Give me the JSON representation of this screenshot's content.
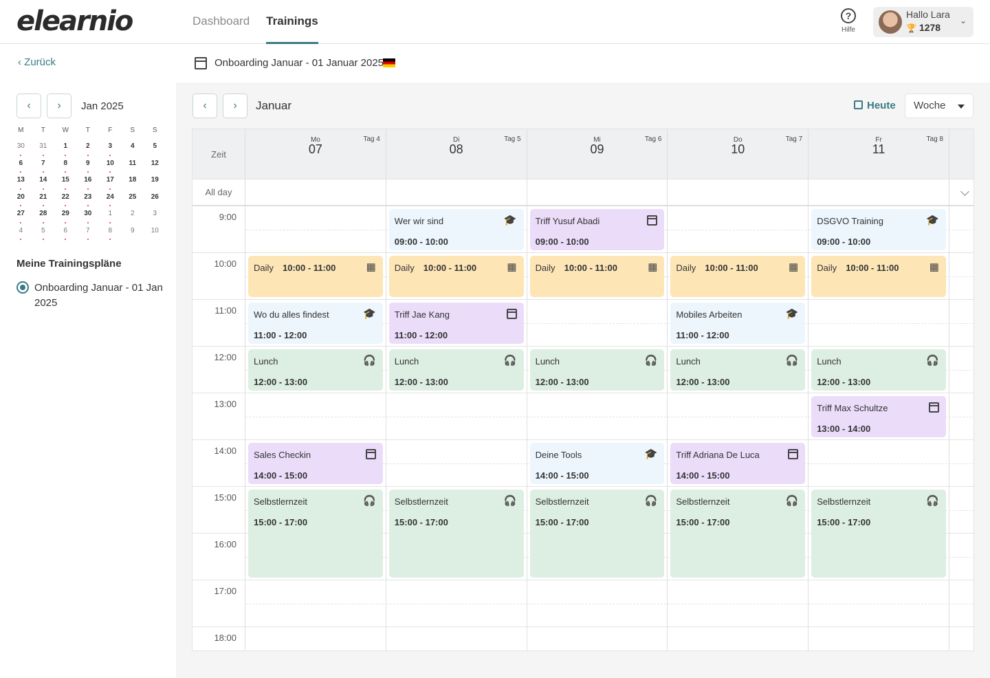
{
  "app": {
    "logo": "elearnio"
  },
  "nav": {
    "tabs": [
      {
        "label": "Dashboard"
      },
      {
        "label": "Trainings"
      }
    ],
    "active": "Trainings"
  },
  "help": {
    "label": "Hilfe"
  },
  "user": {
    "greeting": "Hallo Lara",
    "points": "1278"
  },
  "sidebar": {
    "back_label": "Zurück",
    "mini_calendar": {
      "label": "Jan 2025",
      "weekdays": [
        "M",
        "T",
        "W",
        "T",
        "F",
        "S",
        "S"
      ],
      "weeks": [
        [
          "30",
          "31",
          "1",
          "2",
          "3",
          "4",
          "5"
        ],
        [
          "6",
          "7",
          "8",
          "9",
          "10",
          "11",
          "12"
        ],
        [
          "13",
          "14",
          "15",
          "16",
          "17",
          "18",
          "19"
        ],
        [
          "20",
          "21",
          "22",
          "23",
          "24",
          "25",
          "26"
        ],
        [
          "27",
          "28",
          "29",
          "30",
          "1",
          "2",
          "3"
        ],
        [
          "4",
          "5",
          "6",
          "7",
          "8",
          "9",
          "10"
        ]
      ]
    },
    "plans_title": "Meine Trainingspläne",
    "plan_label": "Onboarding Januar - 01 Jan 2025"
  },
  "course": {
    "title": "Onboarding Januar - 01 Januar 2025"
  },
  "calendar": {
    "month_label": "Januar",
    "today_label": "Heute",
    "view": "Woche",
    "zeit_label": "Zeit",
    "allday_label": "All day",
    "days": [
      {
        "dow": "Mo",
        "num": "07",
        "tag": "Tag 4"
      },
      {
        "dow": "Di",
        "num": "08",
        "tag": "Tag 5"
      },
      {
        "dow": "Mi",
        "num": "09",
        "tag": "Tag 6"
      },
      {
        "dow": "Do",
        "num": "10",
        "tag": "Tag 7"
      },
      {
        "dow": "Fr",
        "num": "11",
        "tag": "Tag 8"
      }
    ],
    "hours": [
      "9:00",
      "10:00",
      "11:00",
      "12:00",
      "13:00",
      "14:00",
      "15:00",
      "16:00",
      "17:00",
      "18:00"
    ],
    "events": [
      {
        "day": 1,
        "title": "Wer wir sind",
        "time": "09:00 - 10:00",
        "color": "#edf6fd",
        "icon": "graduation-cap-icon"
      },
      {
        "day": 2,
        "title": "Triff Yusuf Abadi",
        "time": "09:00 - 10:00",
        "color": "#ebdcfa",
        "icon": "calendar-icon"
      },
      {
        "day": 4,
        "title": "DSGVO Training",
        "time": "09:00 - 10:00",
        "color": "#edf6fd",
        "icon": "graduation-cap-icon"
      },
      {
        "day": 0,
        "title": "Daily",
        "time": "10:00 - 11:00",
        "color": "#fde5b6",
        "icon": "presentation-icon"
      },
      {
        "day": 1,
        "title": "Daily",
        "time": "10:00 - 11:00",
        "color": "#fde5b6",
        "icon": "presentation-icon"
      },
      {
        "day": 2,
        "title": "Daily",
        "time": "10:00 - 11:00",
        "color": "#fde5b6",
        "icon": "presentation-icon"
      },
      {
        "day": 3,
        "title": "Daily",
        "time": "10:00 - 11:00",
        "color": "#fde5b6",
        "icon": "presentation-icon"
      },
      {
        "day": 4,
        "title": "Daily",
        "time": "10:00 - 11:00",
        "color": "#fde5b6",
        "icon": "presentation-icon"
      },
      {
        "day": 0,
        "title": "Wo du alles findest",
        "time": "11:00 - 12:00",
        "color": "#edf6fd",
        "icon": "graduation-cap-icon"
      },
      {
        "day": 1,
        "title": "Triff Jae Kang",
        "time": "11:00 - 12:00",
        "color": "#ebdcfa",
        "icon": "calendar-icon"
      },
      {
        "day": 3,
        "title": "Mobiles Arbeiten",
        "time": "11:00 - 12:00",
        "color": "#edf6fd",
        "icon": "graduation-cap-icon"
      },
      {
        "day": 0,
        "title": "Lunch",
        "time": "12:00 - 13:00",
        "color": "#ddeee2",
        "icon": "headphones-icon"
      },
      {
        "day": 1,
        "title": "Lunch",
        "time": "12:00 - 13:00",
        "color": "#ddeee2",
        "icon": "headphones-icon"
      },
      {
        "day": 2,
        "title": "Lunch",
        "time": "12:00 - 13:00",
        "color": "#ddeee2",
        "icon": "headphones-icon"
      },
      {
        "day": 3,
        "title": "Lunch",
        "time": "12:00 - 13:00",
        "color": "#ddeee2",
        "icon": "headphones-icon"
      },
      {
        "day": 4,
        "title": "Lunch",
        "time": "12:00 - 13:00",
        "color": "#ddeee2",
        "icon": "headphones-icon"
      },
      {
        "day": 4,
        "title": "Triff Max Schultze",
        "time": "13:00 - 14:00",
        "color": "#ebdcfa",
        "icon": "calendar-icon"
      },
      {
        "day": 0,
        "title": "Sales Checkin",
        "time": "14:00 - 15:00",
        "color": "#ebdcfa",
        "icon": "calendar-icon"
      },
      {
        "day": 2,
        "title": "Deine Tools",
        "time": "14:00 - 15:00",
        "color": "#edf6fd",
        "icon": "graduation-cap-icon"
      },
      {
        "day": 3,
        "title": "Triff Adriana De Luca",
        "time": "14:00 - 15:00",
        "color": "#ebdcfa",
        "icon": "calendar-icon"
      },
      {
        "day": 0,
        "title": "Selbstlernzeit",
        "time": "15:00 - 17:00",
        "color": "#ddeee2",
        "icon": "headphones-icon"
      },
      {
        "day": 1,
        "title": "Selbstlernzeit",
        "time": "15:00 - 17:00",
        "color": "#ddeee2",
        "icon": "headphones-icon"
      },
      {
        "day": 2,
        "title": "Selbstlernzeit",
        "time": "15:00 - 17:00",
        "color": "#ddeee2",
        "icon": "headphones-icon"
      },
      {
        "day": 3,
        "title": "Selbstlernzeit",
        "time": "15:00 - 17:00",
        "color": "#ddeee2",
        "icon": "headphones-icon"
      },
      {
        "day": 4,
        "title": "Selbstlernzeit",
        "time": "15:00 - 17:00",
        "color": "#ddeee2",
        "icon": "headphones-icon"
      }
    ]
  }
}
